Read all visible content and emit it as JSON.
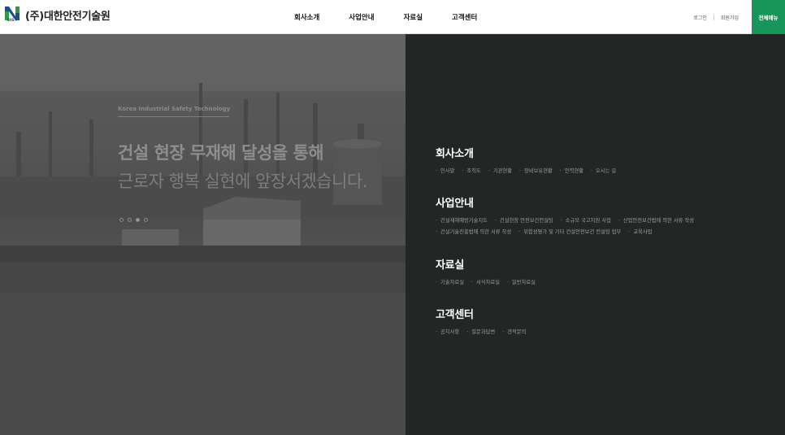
{
  "header": {
    "logo_sub": "DIST",
    "logo_name": "(주)대한안전기술원",
    "nav": [
      "회사소개",
      "사업안내",
      "자료실",
      "고객센터"
    ],
    "login": "로그인",
    "signup": "회원가입",
    "all_menu": "전체메뉴",
    "accent_color": "#17955a"
  },
  "hero": {
    "eyebrow": "Korea Industrial Safety Technology",
    "title_line1": "건설 현장 무재해 달성을 통해",
    "title_line2": "근로자 행복 실현에 앞장서겠습니다.",
    "slides": 4,
    "active_slide": 3
  },
  "menu": [
    {
      "title": "회사소개",
      "items": [
        "인사말",
        "조직도",
        "기관현황",
        "장비보유현황",
        "인력현황",
        "오시는 길"
      ]
    },
    {
      "title": "사업안내",
      "items_row1": [
        "건설재해예방기술지도",
        "건설현장 안전보건컨설팅",
        "소규모 국고지원 사업",
        "산업안전보건법에 의한 서류 작성"
      ],
      "items_row2": [
        "건설기술진흥법에 의한 서류 작성",
        "위험성평가 및 기타 건설안전보건 컨설팅 업무",
        "교육사업"
      ]
    },
    {
      "title": "자료실",
      "items": [
        "기술자료실",
        "서식자료실",
        "일반자료실"
      ]
    },
    {
      "title": "고객센터",
      "items": [
        "공지사항",
        "질문과답변",
        "견적문의"
      ]
    }
  ]
}
